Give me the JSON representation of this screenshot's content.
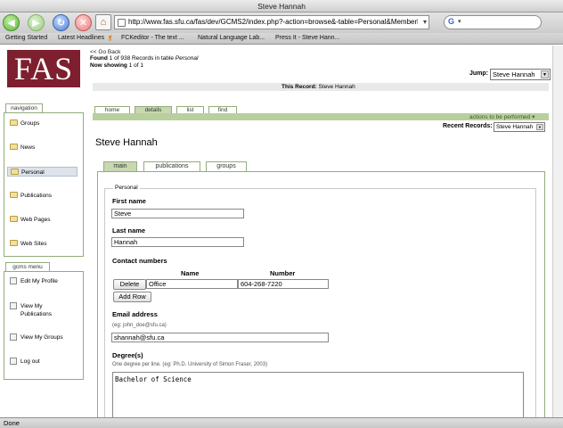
{
  "window": {
    "title": "Steve Hannah"
  },
  "toolbar": {
    "url": "http://www.fas.sfu.ca/fas/dev/GCMS2/index.php?-action=browse&-table=Personal&Memberl",
    "url_go": "▾",
    "search_engine_letter": "G"
  },
  "bookmarks": [
    "Getting Started",
    "Latest Headlines",
    "FCKeditor - The text ...",
    "Natural Language Lab...",
    "Press It - Steve Hann..."
  ],
  "header": {
    "logo_text": "FAS",
    "go_back": "<< Go Back",
    "found_prefix": "Found",
    "found_count": "1",
    "found_mid": "of 938 Records in table",
    "found_table": "Personal",
    "showing_prefix": "Now showing",
    "showing_value": "1 of 1",
    "jump_label": "Jump:",
    "jump_value": "Steve Hannah",
    "this_record_label": "This Record:",
    "this_record_value": "Steve Hannah"
  },
  "navigation": {
    "tab_label": "navigation",
    "items": [
      {
        "label": "Groups"
      },
      {
        "label": "News"
      },
      {
        "label": "Personal"
      },
      {
        "label": "Publications"
      },
      {
        "label": "Web Pages"
      },
      {
        "label": "Web Sites"
      }
    ]
  },
  "gcms_menu": {
    "tab_label": "gcms menu",
    "items": [
      {
        "line1": "Edit My Profile",
        "line2": ""
      },
      {
        "line1": "View My",
        "line2": "Publications"
      },
      {
        "line1": "View My Groups",
        "line2": ""
      },
      {
        "line1": "Log out",
        "line2": ""
      }
    ]
  },
  "main_tabs": [
    {
      "label": "home"
    },
    {
      "label": "details"
    },
    {
      "label": "list"
    },
    {
      "label": "find"
    }
  ],
  "actions_label": "actions to be performed ▾",
  "recent": {
    "label": "Recent Records:",
    "value": "Steve Hannah"
  },
  "record_title": "Steve Hannah",
  "sub_tabs": [
    {
      "label": "main"
    },
    {
      "label": "publications"
    },
    {
      "label": "groups"
    }
  ],
  "form": {
    "legend": "Personal",
    "first_name_label": "First name",
    "first_name_value": "Steve",
    "last_name_label": "Last name",
    "last_name_value": "Hannah",
    "contact_label": "Contact numbers",
    "col_name": "Name",
    "col_number": "Number",
    "delete_label": "Delete",
    "contact_name_value": "Office",
    "contact_number_value": "604-268-7220",
    "add_row_label": "Add Row",
    "email_label": "Email address",
    "email_hint": "(eg: john_doe@sfu.ca)",
    "email_value": "shannah@sfu.ca",
    "degrees_label": "Degree(s)",
    "degrees_hint": "One degree per line. (eg: Ph.D. University of Simon Fraser, 2003)",
    "degrees_value": "Bachelor of Science"
  },
  "status": {
    "text": "Done"
  }
}
